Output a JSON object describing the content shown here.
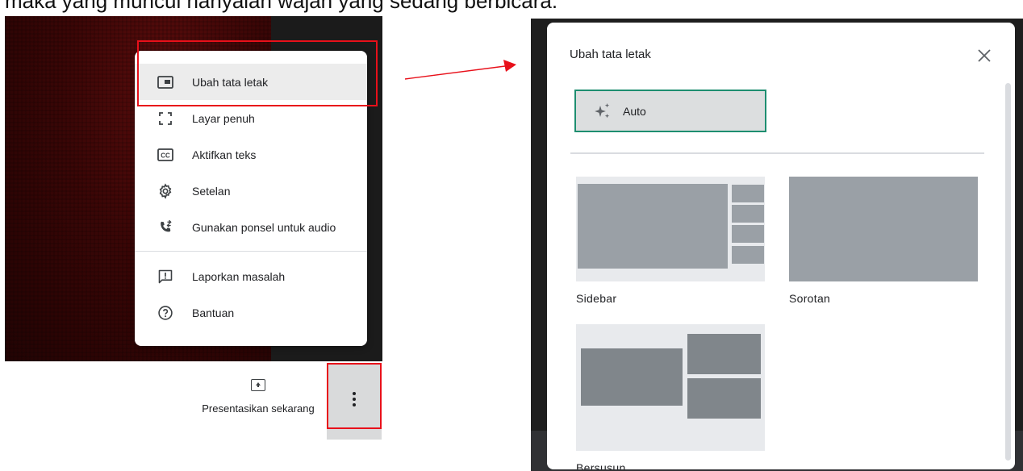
{
  "caption": "maka yang muncul hanyalah wajah yang sedang berbicara.",
  "meet": {
    "present_label": "Presentasikan sekarang",
    "more_button_icon": "more-vert-icon",
    "menu": {
      "items": [
        {
          "label": "Ubah tata letak",
          "icon": "layout-icon"
        },
        {
          "label": "Layar penuh",
          "icon": "fullscreen-icon"
        },
        {
          "label": "Aktifkan teks",
          "icon": "captions-icon"
        },
        {
          "label": "Setelan",
          "icon": "gear-icon"
        },
        {
          "label": "Gunakan ponsel untuk audio",
          "icon": "phone-forward-icon"
        }
      ],
      "secondary_items": [
        {
          "label": "Laporkan masalah",
          "icon": "feedback-icon"
        },
        {
          "label": "Bantuan",
          "icon": "help-icon"
        }
      ]
    }
  },
  "dialog": {
    "title": "Ubah tata letak",
    "close_icon": "close-icon",
    "auto_label": "Auto",
    "auto_icon": "sparkle-icon",
    "options": [
      {
        "label": "Sidebar"
      },
      {
        "label": "Sorotan"
      },
      {
        "label": "Bersusun"
      }
    ]
  },
  "colors": {
    "highlight_red": "#e8101a",
    "selected_border": "#1e8e70",
    "thumb_block": "#9aa0a6",
    "thumb_bg": "#e8eaed"
  }
}
